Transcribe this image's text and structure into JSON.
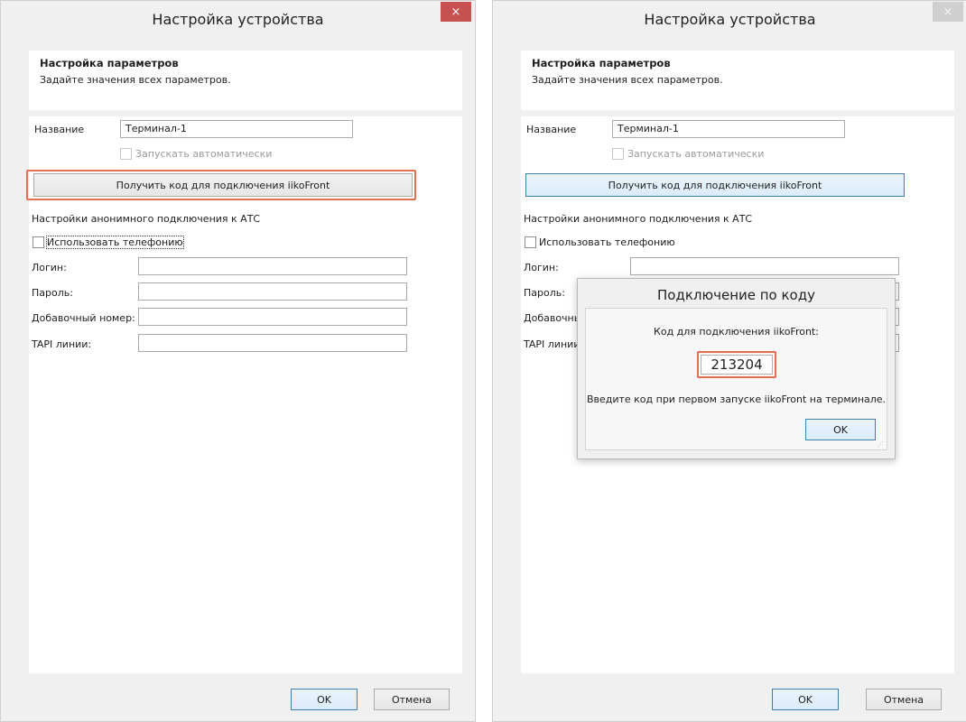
{
  "left_window": {
    "title": "Настройка устройства",
    "close_glyph": "×",
    "header": {
      "title": "Настройка параметров",
      "subtitle": "Задайте значения всех параметров."
    },
    "form": {
      "name_label": "Название",
      "name_value": "Терминал-1",
      "autostart_label": "Запускать автоматически",
      "get_code_button": "Получить код для подключения iikoFront",
      "pbx_section": "Настройки анонимного подключения к АТС",
      "use_telephony_label": "Использовать телефонию",
      "login_label": "Логин:",
      "password_label": "Пароль:",
      "extension_label": "Добавочный номер:",
      "tapi_label": "TAPI линии:"
    },
    "ok_button": "OK",
    "cancel_button": "Отмена"
  },
  "right_window": {
    "title": "Настройка устройства",
    "close_glyph": "×",
    "header": {
      "title": "Настройка параметров",
      "subtitle": "Задайте значения всех параметров."
    },
    "form": {
      "name_label": "Название",
      "name_value": "Терминал-1",
      "autostart_label": "Запускать автоматически",
      "get_code_button": "Получить код для подключения iikoFront",
      "pbx_section": "Настройки анонимного подключения к АТС",
      "use_telephony_label": "Использовать телефонию",
      "login_label": "Логин:",
      "password_label": "Пароль:",
      "extension_label": "Добавочны",
      "tapi_label": "TAPI линии"
    },
    "ok_button": "OK",
    "cancel_button": "Отмена"
  },
  "popup": {
    "title": "Подключение по коду",
    "caption": "Код для подключения iikoFront:",
    "code": "213204",
    "hint": "Введите код при первом запуске iikoFront на терминале.",
    "ok_button": "OK"
  },
  "colors": {
    "highlight": "#e07050",
    "close_active": "#c75050",
    "focus_border": "#3c7fb1"
  }
}
